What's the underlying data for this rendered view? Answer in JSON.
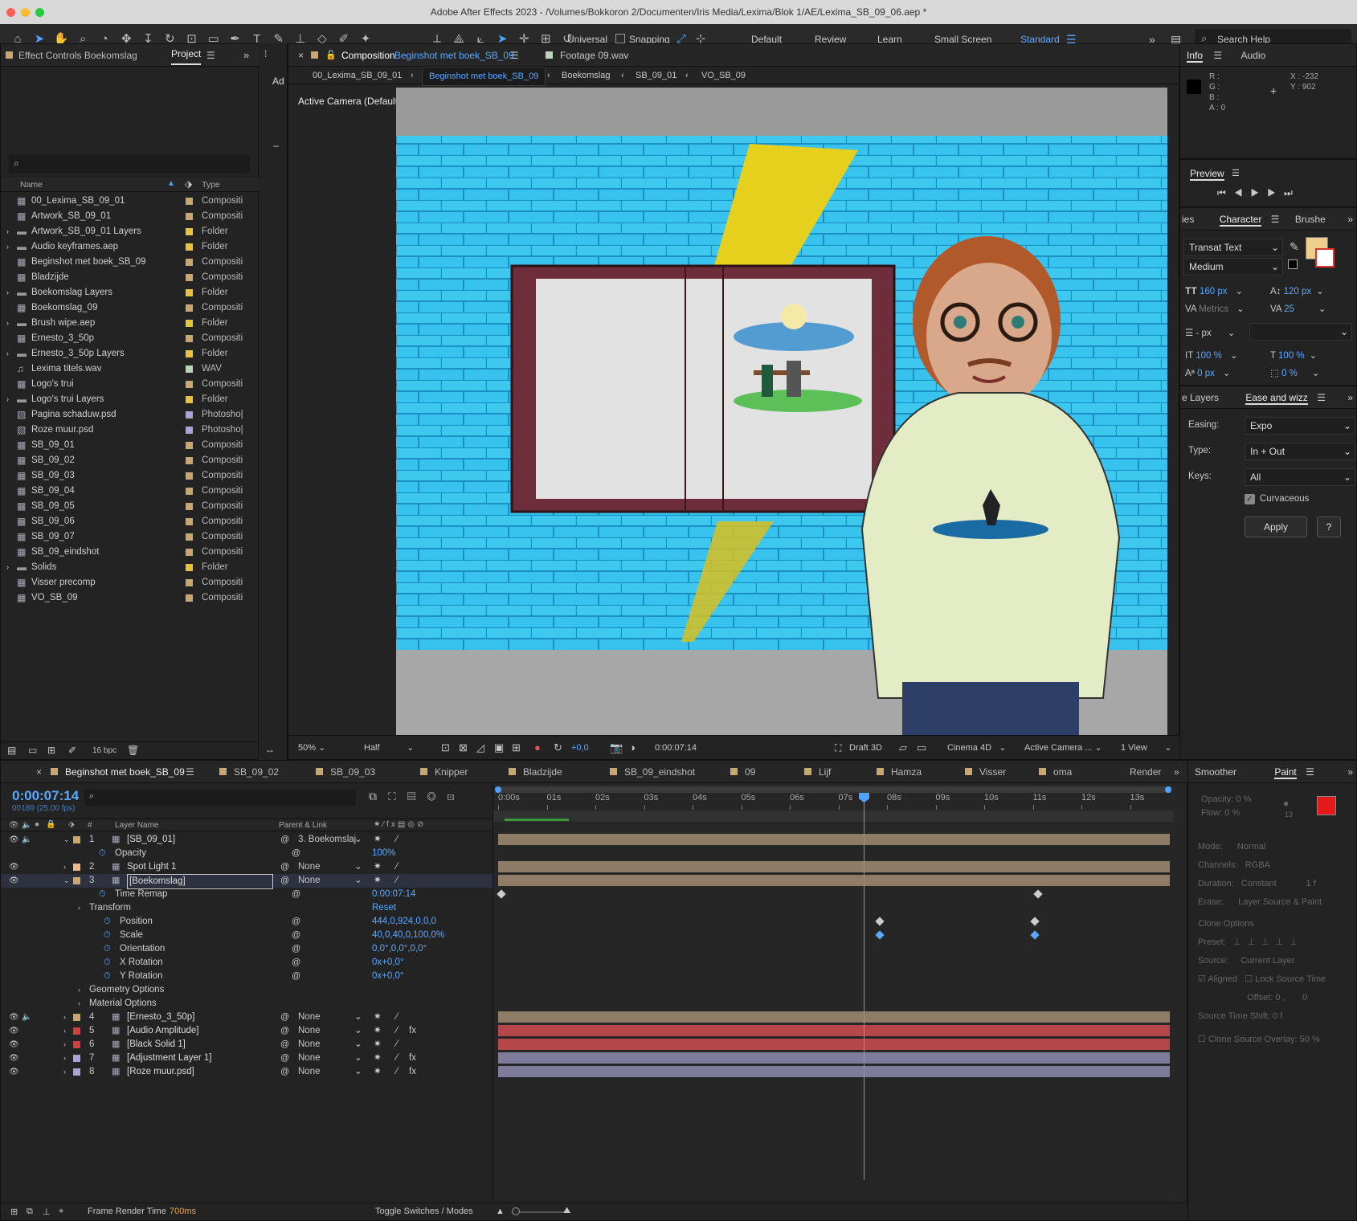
{
  "window": {
    "title": "Adobe After Effects 2023 - /Volumes/Bokkoron 2/Documenten/Iris Media/Lexima/Blok 1/AE/Lexima_SB_09_06.aep *"
  },
  "toolbar": {
    "universal": "Universal",
    "snapping": "Snapping",
    "workspaces": [
      "Default",
      "Review",
      "Learn",
      "Small Screen",
      "Standard"
    ],
    "search_placeholder": "Search Help"
  },
  "left_panel": {
    "effect_controls": "Effect Controls Boekomslag",
    "project_tab": "Project",
    "col_name": "Name",
    "col_type": "Type",
    "bpc": "16 bpc",
    "items": [
      {
        "name": "00_Lexima_SB_09_01",
        "type": "Compositi",
        "color": "#c9a76f",
        "kind": "comp"
      },
      {
        "name": "Artwork_SB_09_01",
        "type": "Compositi",
        "color": "#c9a76f",
        "kind": "comp"
      },
      {
        "name": "Artwork_SB_09_01 Layers",
        "type": "Folder",
        "color": "#e7c33f",
        "kind": "folder"
      },
      {
        "name": "Audio keyframes.aep",
        "type": "Folder",
        "color": "#e7c33f",
        "kind": "folder"
      },
      {
        "name": "Beginshot met boek_SB_09",
        "type": "Compositi",
        "color": "#c9a76f",
        "kind": "comp"
      },
      {
        "name": "Bladzijde",
        "type": "Compositi",
        "color": "#c9a76f",
        "kind": "comp"
      },
      {
        "name": "Boekomslag Layers",
        "type": "Folder",
        "color": "#e7c33f",
        "kind": "folder"
      },
      {
        "name": "Boekomslag_09",
        "type": "Compositi",
        "color": "#c9a76f",
        "kind": "comp"
      },
      {
        "name": "Brush wipe.aep",
        "type": "Folder",
        "color": "#e7c33f",
        "kind": "folder"
      },
      {
        "name": "Ernesto_3_50p",
        "type": "Compositi",
        "color": "#c9a76f",
        "kind": "comp"
      },
      {
        "name": "Ernesto_3_50p Layers",
        "type": "Folder",
        "color": "#e7c33f",
        "kind": "folder"
      },
      {
        "name": "Lexima titels.wav",
        "type": "WAV",
        "color": "#bcd3bc",
        "kind": "audio"
      },
      {
        "name": "Logo's trui",
        "type": "Compositi",
        "color": "#c9a76f",
        "kind": "comp"
      },
      {
        "name": "Logo's trui Layers",
        "type": "Folder",
        "color": "#e7c33f",
        "kind": "folder"
      },
      {
        "name": "Pagina schaduw.psd",
        "type": "Photosho|",
        "color": "#a9a3d6",
        "kind": "psd"
      },
      {
        "name": "Roze muur.psd",
        "type": "Photosho|",
        "color": "#a9a3d6",
        "kind": "psd"
      },
      {
        "name": "SB_09_01",
        "type": "Compositi",
        "color": "#c9a76f",
        "kind": "comp"
      },
      {
        "name": "SB_09_02",
        "type": "Compositi",
        "color": "#c9a76f",
        "kind": "comp"
      },
      {
        "name": "SB_09_03",
        "type": "Compositi",
        "color": "#c9a76f",
        "kind": "comp"
      },
      {
        "name": "SB_09_04",
        "type": "Compositi",
        "color": "#c9a76f",
        "kind": "comp"
      },
      {
        "name": "SB_09_05",
        "type": "Compositi",
        "color": "#c9a76f",
        "kind": "comp"
      },
      {
        "name": "SB_09_06",
        "type": "Compositi",
        "color": "#c9a76f",
        "kind": "comp"
      },
      {
        "name": "SB_09_07",
        "type": "Compositi",
        "color": "#c9a76f",
        "kind": "comp"
      },
      {
        "name": "SB_09_eindshot",
        "type": "Compositi",
        "color": "#c9a76f",
        "kind": "comp"
      },
      {
        "name": "Solids",
        "type": "Folder",
        "color": "#e7c33f",
        "kind": "folder"
      },
      {
        "name": "Visser precomp",
        "type": "Compositi",
        "color": "#c9a76f",
        "kind": "comp"
      },
      {
        "name": "VO_SB_09",
        "type": "Compositi",
        "color": "#c9a76f",
        "kind": "comp"
      }
    ]
  },
  "viewer": {
    "tab_prefix": "Composition",
    "tab_comp": "Beginshot met boek_SB_09",
    "footage_tab": "Footage 09.wav",
    "breadcrumbs": [
      "00_Lexima_SB_09_01",
      "Beginshot met boek_SB_09",
      "Boekomslag",
      "SB_09_01",
      "VO_SB_09"
    ],
    "camera_label": "Active Camera (Default)",
    "side_label": "Ad",
    "bottom": {
      "zoom": "50%",
      "resolution": "Half",
      "exposure": "+0,0",
      "time": "0:00:07:14",
      "renderer": "Draft 3D",
      "engine": "Cinema 4D",
      "camera": "Active Camera ...",
      "views": "1 View"
    }
  },
  "right_panel": {
    "info_tab": "Info",
    "audio_tab": "Audio",
    "info": {
      "r": "R :",
      "g": "G :",
      "b": "B :",
      "a": "A : 0",
      "x": "X : -232",
      "y": "Y : 902"
    },
    "preview": "Preview",
    "char_tabs": [
      "ies",
      "Character",
      "Brushe"
    ],
    "character": {
      "font": "Transat Text",
      "style": "Medium",
      "size": "160 px",
      "leading": "120 px",
      "kerning": "Metrics",
      "tracking": "25",
      "stroke": "- px",
      "vscale": "100 %",
      "hscale": "100 %",
      "baseline": "0 px",
      "tsume": "0 %"
    },
    "ease_tabs": [
      "e Layers",
      "Ease and wizz"
    ],
    "ease": {
      "easing_label": "Easing:",
      "easing": "Expo",
      "type_label": "Type:",
      "type": "In + Out",
      "keys_label": "Keys:",
      "keys": "All",
      "curvaceous": "Curvaceous",
      "apply": "Apply",
      "help": "?"
    }
  },
  "timeline": {
    "tabs": [
      "Beginshot met boek_SB_09",
      "SB_09_02",
      "SB_09_03",
      "Knipper",
      "Bladzijde",
      "SB_09_eindshot",
      "09",
      "Lijf",
      "Hamza",
      "Visser",
      "oma",
      "Render"
    ],
    "timecode": "0:00:07:14",
    "fps": "00189 (25.00 fps)",
    "col_layer": "Layer Name",
    "col_parent": "Parent & Link",
    "col_num": "#",
    "ruler": [
      "0:00s",
      "01s",
      "02s",
      "03s",
      "04s",
      "05s",
      "06s",
      "07s",
      "08s",
      "09s",
      "10s",
      "11s",
      "12s",
      "13s"
    ],
    "rows": [
      {
        "num": "1",
        "name": "[SB_09_01]",
        "parent": "3. Boekomslaj",
        "color": "#c9a76f",
        "kind": "layer"
      },
      {
        "name": "Opacity",
        "value": "100%",
        "kind": "prop1"
      },
      {
        "num": "2",
        "name": "Spot Light 1",
        "parent": "None",
        "color": "#e9b98c",
        "kind": "layer"
      },
      {
        "num": "3",
        "name": "[Boekomslag]",
        "parent": "None",
        "color": "#c9a76f",
        "kind": "layer"
      },
      {
        "name": "Time Remap",
        "value": "0:00:07:14",
        "kind": "prop1"
      },
      {
        "name": "Transform",
        "value": "Reset",
        "kind": "group"
      },
      {
        "name": "Position",
        "value": "444,0,924,0,0,0",
        "kind": "prop2"
      },
      {
        "name": "Scale",
        "value": "40,0,40,0,100,0%",
        "kind": "prop2"
      },
      {
        "name": "Orientation",
        "value": "0,0°,0,0°,0,0°",
        "kind": "prop2"
      },
      {
        "name": "X Rotation",
        "value": "0x+0,0°",
        "kind": "prop2"
      },
      {
        "name": "Y Rotation",
        "value": "0x+0,0°",
        "kind": "prop2"
      },
      {
        "name": "Geometry Options",
        "value": "",
        "kind": "group"
      },
      {
        "name": "Material Options",
        "value": "",
        "kind": "group"
      },
      {
        "num": "4",
        "name": "[Ernesto_3_50p]",
        "parent": "None",
        "color": "#c9a76f",
        "kind": "layer"
      },
      {
        "num": "5",
        "name": "[Audio Amplitude]",
        "parent": "None",
        "color": "#d04040",
        "kind": "layer"
      },
      {
        "num": "6",
        "name": "[Black Solid 1]",
        "parent": "None",
        "color": "#d04040",
        "kind": "layer"
      },
      {
        "num": "7",
        "name": "[Adjustment Layer 1]",
        "parent": "None",
        "color": "#a9a3d6",
        "kind": "layer"
      },
      {
        "num": "8",
        "name": "[Roze muur.psd]",
        "parent": "None",
        "color": "#a9a3d6",
        "kind": "layer"
      }
    ],
    "footer": {
      "render_label": "Frame Render Time",
      "render_value": "700ms",
      "toggle": "Toggle Switches / Modes"
    }
  },
  "paint_panel": {
    "tabs": [
      "Smoother",
      "Paint"
    ],
    "opacity": "Opacity: 0 %",
    "flow": "Flow: 0 %",
    "mode_label": "Mode:",
    "mode": "Normal",
    "channels_label": "Channels:",
    "channels": "RGBA",
    "duration_label": "Duration:",
    "duration": "Constant",
    "erase_label": "Erase:",
    "erase": "Layer Source & Paint",
    "clone_options": "Clone Options",
    "preset_label": "Preset:",
    "source_label": "Source:",
    "source": "Current Layer",
    "aligned": "Aligned",
    "lock_source": "Lock Source Time",
    "offset": "Offset: 0 ,",
    "offset_y": "0",
    "shift": "Source Time Shift: 0",
    "shift_f": "f",
    "overlay": "Clone Source Overlay:",
    "overlay_val": "50 %",
    "num13": "13",
    "f1": "1 f"
  }
}
